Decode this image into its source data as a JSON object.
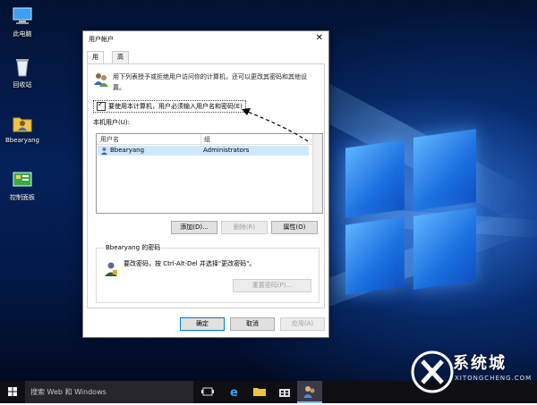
{
  "desktop": {
    "icons": [
      {
        "label": "此电脑",
        "icon": "this-pc-icon"
      },
      {
        "label": "回收站",
        "icon": "recycle-bin-icon"
      },
      {
        "label": "Bbearyang",
        "icon": "user-folder-icon"
      },
      {
        "label": "控制面板",
        "icon": "control-panel-icon"
      }
    ]
  },
  "dialog": {
    "title": "用户帐户",
    "close_glyph": "✕",
    "tabs": [
      {
        "label": "用户",
        "active": true
      },
      {
        "label": "高级",
        "active": false
      }
    ],
    "description": "用下列表授予或拒绝用户访问你的计算机，还可以更改其密码和其他设置。",
    "require_password_checkbox": {
      "label": "要使用本计算机，用户必须输入用户名和密码(E)",
      "checked": true
    },
    "user_list_label": "本机用户(U):",
    "columns": [
      "用户名",
      "组"
    ],
    "rows": [
      {
        "username": "Bbearyang",
        "group": "Administrators"
      }
    ],
    "buttons": {
      "add": "添加(D)...",
      "remove": "删除(R)",
      "properties": "属性(O)"
    },
    "password_group": {
      "title": "Bbearyang 的密码",
      "text": "要改密码，按 Ctrl-Alt-Del 并选择\"更改密码\"。",
      "reset_button": "重置密码(P)..."
    },
    "footer": {
      "ok": "确定",
      "cancel": "取消",
      "apply": "应用(A)"
    }
  },
  "taskbar": {
    "search_placeholder": "搜索 Web 和 Windows",
    "items": [
      "task-view-icon",
      "edge-icon",
      "file-explorer-icon",
      "store-icon",
      "user-accounts-icon"
    ]
  },
  "watermark": {
    "brand": "系统城",
    "url": "XITONGCHENG.COM"
  },
  "colors": {
    "accent": "#0078d7",
    "selection": "#cde8ff",
    "taskbar": "#0f0f13"
  }
}
